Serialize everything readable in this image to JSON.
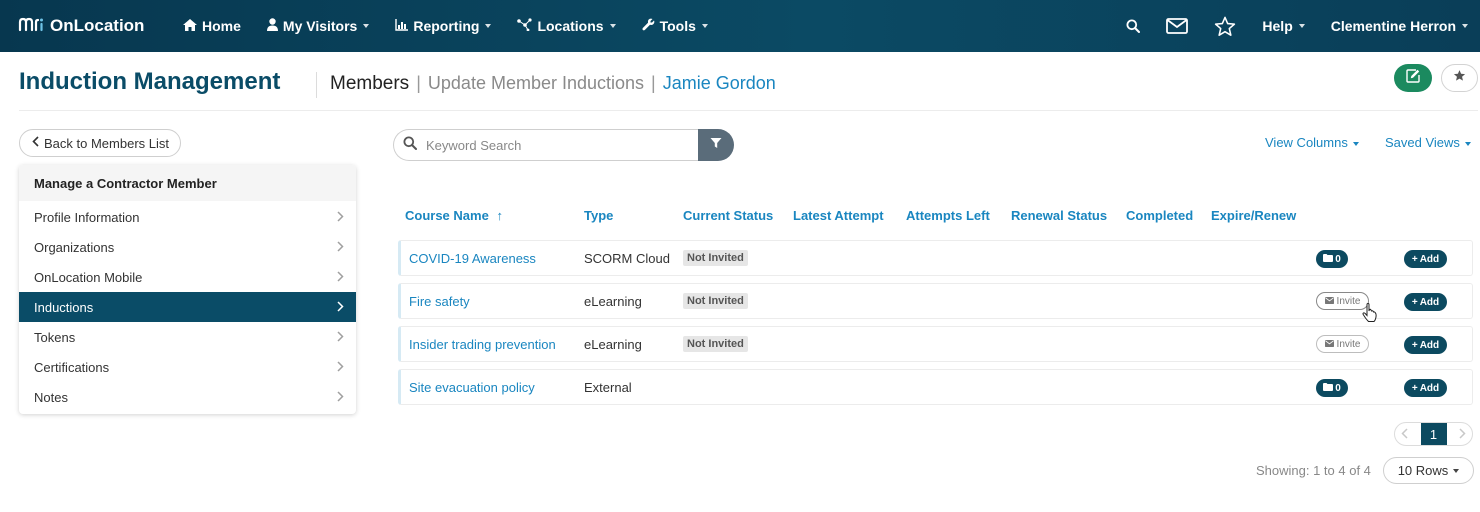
{
  "navbar": {
    "brand_mark": "mri",
    "brand_name": "OnLocation",
    "items": [
      {
        "label": "Home",
        "icon": "home-icon"
      },
      {
        "label": "My Visitors",
        "icon": "user-icon"
      },
      {
        "label": "Reporting",
        "icon": "bar-chart-icon"
      },
      {
        "label": "Locations",
        "icon": "network-icon"
      },
      {
        "label": "Tools",
        "icon": "wrench-icon"
      }
    ],
    "help_label": "Help",
    "user_name": "Clementine Herron"
  },
  "header": {
    "title": "Induction Management",
    "breadcrumb": {
      "members": "Members",
      "separator": "|",
      "update": "Update Member Inductions",
      "person": "Jamie Gordon"
    }
  },
  "sidebar": {
    "back_label": "Back to Members List",
    "heading": "Manage a Contractor Member",
    "items": [
      {
        "label": "Profile Information",
        "active": false
      },
      {
        "label": "Organizations",
        "active": false
      },
      {
        "label": "OnLocation Mobile",
        "active": false
      },
      {
        "label": "Inductions",
        "active": true
      },
      {
        "label": "Tokens",
        "active": false
      },
      {
        "label": "Certifications",
        "active": false
      },
      {
        "label": "Notes",
        "active": false
      }
    ]
  },
  "toolbar": {
    "search_placeholder": "Keyword Search",
    "view_columns_label": "View Columns",
    "saved_views_label": "Saved Views"
  },
  "table": {
    "columns": [
      "Course Name",
      "Type",
      "Current Status",
      "Latest Attempt",
      "Attempts Left",
      "Renewal Status",
      "Completed",
      "Expire/Renew"
    ],
    "sort_indicator": "↑",
    "rows": [
      {
        "course": "COVID-19 Awareness",
        "type": "SCORM Cloud",
        "status": "Not Invited",
        "action": "folder",
        "action_label": "0",
        "add_label": "Add"
      },
      {
        "course": "Fire safety",
        "type": "eLearning",
        "status": "Not Invited",
        "action": "invite",
        "action_label": "Invite",
        "add_label": "Add"
      },
      {
        "course": "Insider trading prevention",
        "type": "eLearning",
        "status": "Not Invited",
        "action": "invite",
        "action_label": "Invite",
        "add_label": "Add"
      },
      {
        "course": "Site evacuation policy",
        "type": "External",
        "status": "",
        "action": "folder",
        "action_label": "0",
        "add_label": "Add"
      }
    ]
  },
  "pagination": {
    "current_page": "1",
    "showing_text": "Showing: 1 to 4 of 4",
    "rows_label": "10 Rows"
  },
  "colors": {
    "navbar": "#0b4a64",
    "accent": "#1a86c0",
    "active_item": "#0a4c67",
    "edit_button": "#1b8a5f",
    "pill": "#0c4a60"
  }
}
